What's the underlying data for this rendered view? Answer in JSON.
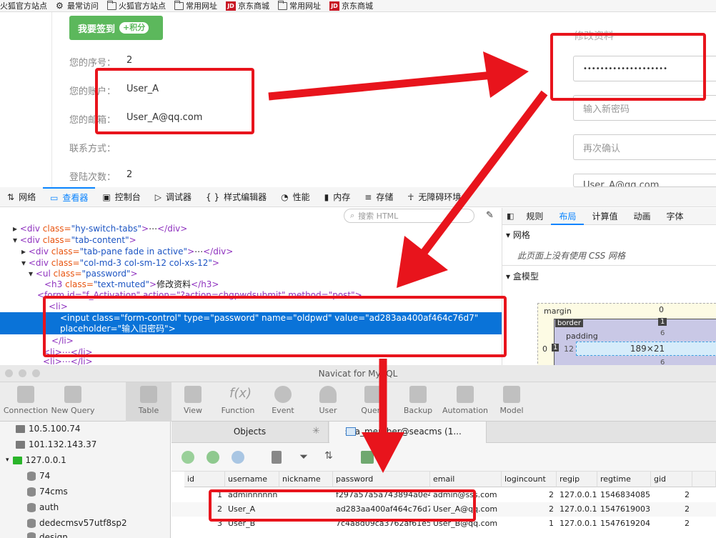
{
  "bookmarks": [
    {
      "label": "火狐官方站点",
      "icon": "page-icon"
    },
    {
      "label": "最常访问",
      "icon": "gear-icon"
    },
    {
      "label": "火狐官方站点",
      "icon": "folder-icon"
    },
    {
      "label": "常用网址",
      "icon": "folder-icon"
    },
    {
      "label": "京东商城",
      "icon": "jd-icon",
      "badge": "JD"
    },
    {
      "label": "常用网址",
      "icon": "folder-icon"
    },
    {
      "label": "京东商城",
      "icon": "jd-icon",
      "badge": "JD"
    }
  ],
  "page": {
    "signin_label": "我要签到",
    "signin_points": "+积分",
    "fields": [
      {
        "label": "您的序号：",
        "value": "2"
      },
      {
        "label": "您的账户：",
        "value": "User_A"
      },
      {
        "label": "您的邮箱：",
        "value": "User_A@qq.com"
      },
      {
        "label": "联系方式：",
        "value": ""
      },
      {
        "label": "登陆次数：",
        "value": "2"
      }
    ],
    "edit_title": "修改资料",
    "old_password_dots": "••••••••••••••••••••",
    "new_password_placeholder": "输入新密码",
    "confirm_placeholder": "再次确认",
    "email_value": "User_A@qq.com"
  },
  "devtools": {
    "tabs": [
      {
        "label": "网络",
        "icon": "network-icon"
      },
      {
        "label": "查看器",
        "icon": "inspector-icon",
        "active": true
      },
      {
        "label": "控制台",
        "icon": "console-icon"
      },
      {
        "label": "调试器",
        "icon": "debugger-icon"
      },
      {
        "label": "样式编辑器",
        "icon": "braces-icon",
        "glyph": "{ }"
      },
      {
        "label": "性能",
        "icon": "performance-icon"
      },
      {
        "label": "内存",
        "icon": "memory-icon"
      },
      {
        "label": "存储",
        "icon": "storage-icon"
      },
      {
        "label": "无障碍环境",
        "icon": "accessibility-icon"
      }
    ],
    "search_placeholder": "搜索 HTML",
    "code": {
      "l1": [
        "<div ",
        "class=",
        "\"hy-switch-tabs\"",
        ">",
        "⋯",
        "</div>"
      ],
      "l2": [
        "<div ",
        "class=",
        "\"tab-content\"",
        ">"
      ],
      "l3": [
        "<div ",
        "class=",
        "\"tab-pane fade in active\"",
        ">",
        "⋯",
        "</div>"
      ],
      "l4": [
        "<div ",
        "class=",
        "\"col-md-3 col-sm-12 col-xs-12\"",
        ">"
      ],
      "l5": [
        "<ul ",
        "class=",
        "\"password\"",
        ">"
      ],
      "l6": [
        "<h3 ",
        "class=",
        "\"text-muted\"",
        ">",
        "修改资料",
        "</h3>"
      ],
      "l7": "<form id=\"f_Activation\" action=\"?action=chgpwdsubmit\" method=\"post\">",
      "l8": "<li>",
      "sel1": "<input class=\"form-control\" type=\"password\" name=\"oldpwd\" value=\"ad283aa400af464c76d7\"",
      "sel2": "placeholder=\"输入旧密码\">",
      "l9": "</li>",
      "l10": "<li>⋯</li>",
      "l11": "<li>⋯</li>"
    },
    "right_tabs": [
      "规则",
      "布局",
      "计算值",
      "动画",
      "字体"
    ],
    "right_active": "布局",
    "grid_section": "网格",
    "grid_note": "此页面上没有使用 CSS 网格",
    "box_section": "盒模型",
    "box": {
      "margin_label": "margin",
      "margin": "0",
      "border_label": "border",
      "border": "1",
      "padding_label": "padding",
      "padding": "6",
      "left_margin": "0",
      "left_border": "1",
      "left_padding": "12",
      "content": "189×21",
      "bottom_padding": "6"
    }
  },
  "navicat": {
    "title": "Navicat for MySQL",
    "toolbar": [
      "Connection",
      "New Query",
      "Table",
      "View",
      "Function",
      "Event",
      "User",
      "Query",
      "Backup",
      "Automation",
      "Model"
    ],
    "active_tool": "Table",
    "connections": [
      {
        "label": "10.5.100.74",
        "type": "server"
      },
      {
        "label": "101.132.143.37",
        "type": "server"
      },
      {
        "label": "127.0.0.1",
        "type": "server-open"
      },
      {
        "label": "74",
        "type": "db"
      },
      {
        "label": "74cms",
        "type": "db"
      },
      {
        "label": "auth",
        "type": "db"
      },
      {
        "label": "dedecmsv57utf8sp2",
        "type": "db"
      },
      {
        "label": "design",
        "type": "db"
      }
    ],
    "tab_objects": "Objects",
    "tab_table": "sea_member@seacms (1...",
    "columns": [
      "id",
      "username",
      "nickname",
      "password",
      "email",
      "logincount",
      "regip",
      "regtime",
      "gid"
    ],
    "rows": [
      {
        "id": "1",
        "username": "adminnnnnn",
        "nickname": "",
        "password": "f297a57a5a743894a0e4",
        "email": "admin@sss.com",
        "logincount": "2",
        "regip": "127.0.0.1",
        "regtime": "1546834085",
        "gid": "2"
      },
      {
        "id": "2",
        "username": "User_A",
        "nickname": "",
        "password": "ad283aa400af464c76d7",
        "email": "User_A@qq.com",
        "logincount": "2",
        "regip": "127.0.0.1",
        "regtime": "1547619003",
        "gid": "2"
      },
      {
        "id": "3",
        "username": "User_B",
        "nickname": "",
        "password": "7c4a8d09ca3762af61e5",
        "email": "User_B@qq.com",
        "logincount": "1",
        "regip": "127.0.0.1",
        "regtime": "1547619204",
        "gid": "2"
      }
    ]
  },
  "colors": {
    "annotation": "#e8141c",
    "selection": "#0a73d8",
    "signin": "#5cb85c"
  }
}
